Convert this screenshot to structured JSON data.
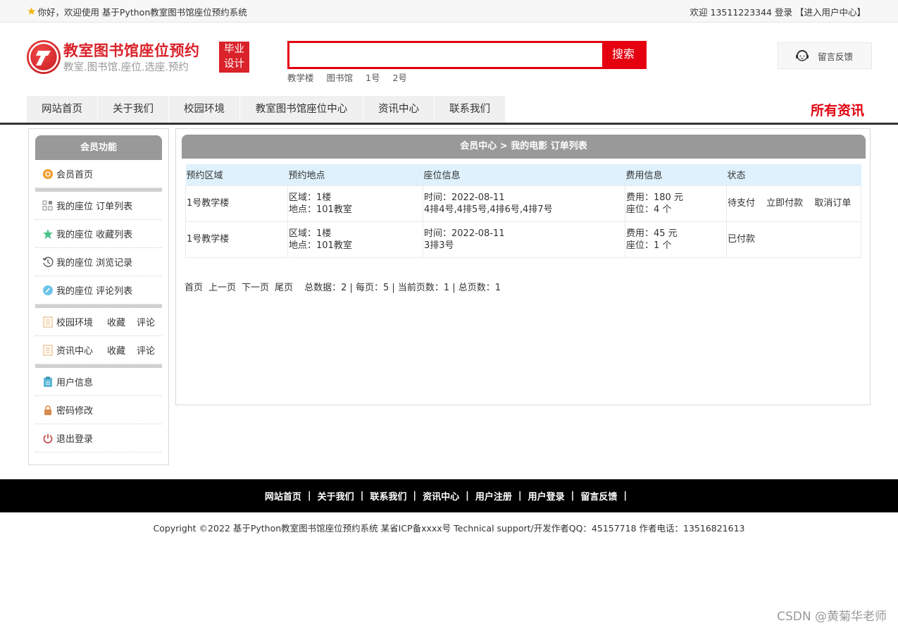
{
  "topbar": {
    "welcome": "你好，欢迎使用 基于Python教室图书馆座位预约系统",
    "user_greeting": "欢迎 13511223344 登录",
    "user_center": "【进入用户中心】"
  },
  "header": {
    "logo_title": "教室图书馆座位预约",
    "logo_sub": "教室.图书馆.座位.选座.预约",
    "badge_line1": "毕业",
    "badge_line2": "设计",
    "search_value": "",
    "search_button": "搜索",
    "hotwords": [
      "教学楼",
      "图书馆",
      "1号",
      "2号"
    ],
    "feedback": "留言反馈"
  },
  "nav": {
    "items": [
      "网站首页",
      "关于我们",
      "校园环境",
      "教室图书馆座位中心",
      "资讯中心",
      "联系我们"
    ],
    "all_news": "所有资讯"
  },
  "sidebar": {
    "title": "会员功能",
    "home": "会员首页",
    "orders": "我的座位 订单列表",
    "favorites": "我的座位 收藏列表",
    "history": "我的座位 浏览记录",
    "comments": "我的座位 评论列表",
    "campus": "校园环境",
    "campus_fav": "收藏",
    "campus_comment": "评论",
    "news": "资讯中心",
    "news_fav": "收藏",
    "news_comment": "评论",
    "user_info": "用户信息",
    "password": "密码修改",
    "logout": "退出登录"
  },
  "content": {
    "breadcrumb": "会员中心 > 我的电影 订单列表",
    "columns": [
      "预约区域",
      "预约地点",
      "座位信息",
      "费用信息",
      "状态"
    ],
    "rows": [
      {
        "area": "1号教学楼",
        "loc1": "区域：1楼",
        "loc2": "地点：101教室",
        "seat1": "时间：2022-08-11",
        "seat2": "4排4号,4排5号,4排6号,4排7号",
        "fee1": "费用：180 元",
        "fee2": "座位：4 个",
        "status": "待支付",
        "action1": "立即付款",
        "action2": "取消订单"
      },
      {
        "area": "1号教学楼",
        "loc1": "区域：1楼",
        "loc2": "地点：101教室",
        "seat1": "时间：2022-08-11",
        "seat2": "3排3号",
        "fee1": "费用：45 元",
        "fee2": "座位：1 个",
        "status": "已付款"
      }
    ],
    "pager": {
      "first": "首页",
      "prev": "上一页",
      "next": "下一页",
      "last": "尾页",
      "stats": "总数据：2 | 每页：5 | 当前页数：1 | 总页数：1"
    }
  },
  "footer": {
    "links": [
      "网站首页",
      "关于我们",
      "联系我们",
      "资讯中心",
      "用户注册",
      "用户登录",
      "留言反馈"
    ],
    "copyright": "Copyright ©2022 基于Python教室图书馆座位预约系统 某省ICP备xxxx号    Technical support/开发作者QQ：45157718     作者电话：13516821613"
  },
  "watermark": "CSDN @黄菊华老师"
}
